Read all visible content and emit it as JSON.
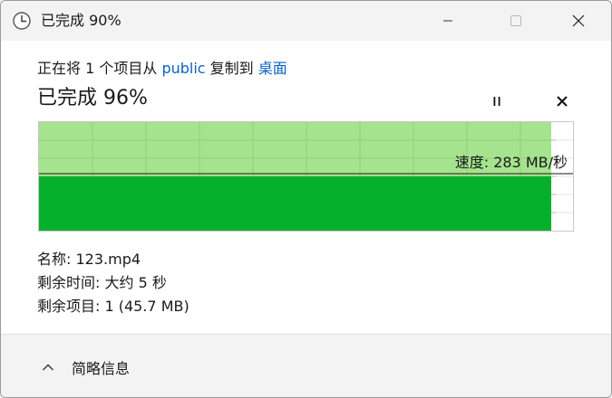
{
  "window": {
    "title": "已完成 90%"
  },
  "titlebar": {
    "icon": "clock-icon",
    "buttons": [
      "minimize-icon",
      "maximize-icon",
      "close-icon"
    ]
  },
  "copy": {
    "prefix": "正在将 1 个项目从 ",
    "source": "public",
    "middle": " 复制到 ",
    "destination": "桌面"
  },
  "progress": {
    "title": "已完成 96%",
    "percent": 96,
    "speed_label": "速度: 283 MB/秒"
  },
  "details": {
    "name": "名称:  123.mp4",
    "remaining_time": "剩余时间:  大约 5 秒",
    "remaining_items": "剩余项目:  1 (45.7 MB)"
  },
  "footer": {
    "toggle_label": "简略信息",
    "toggle_icon": "chevron-up-icon"
  },
  "colors": {
    "progress_fill": "#a6e38e",
    "speed_fill": "#06b02b",
    "link": "#0b62c4"
  }
}
